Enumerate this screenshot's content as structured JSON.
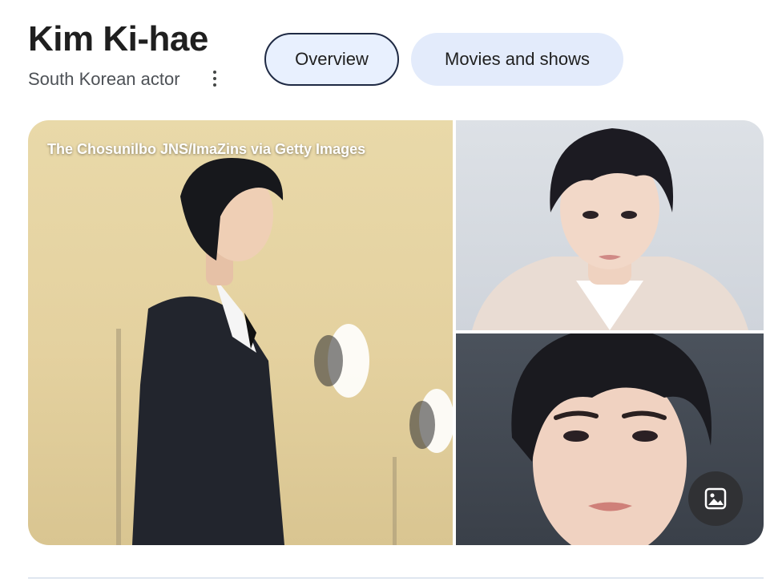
{
  "header": {
    "title": "Kim Ki-hae",
    "subtitle": "South Korean actor",
    "more_icon": "more-vertical-icon"
  },
  "tabs": [
    {
      "label": "Overview",
      "selected": true
    },
    {
      "label": "Movies and shows",
      "selected": false
    }
  ],
  "gallery": {
    "credit": "The Chosunilbo JNS/ImaZins via Getty Images",
    "images_button_icon": "image-icon"
  },
  "colors": {
    "chip_selected_border": "#1f2a44",
    "chip_background": "#e3ebfb",
    "images_button_bg": "#303134"
  }
}
